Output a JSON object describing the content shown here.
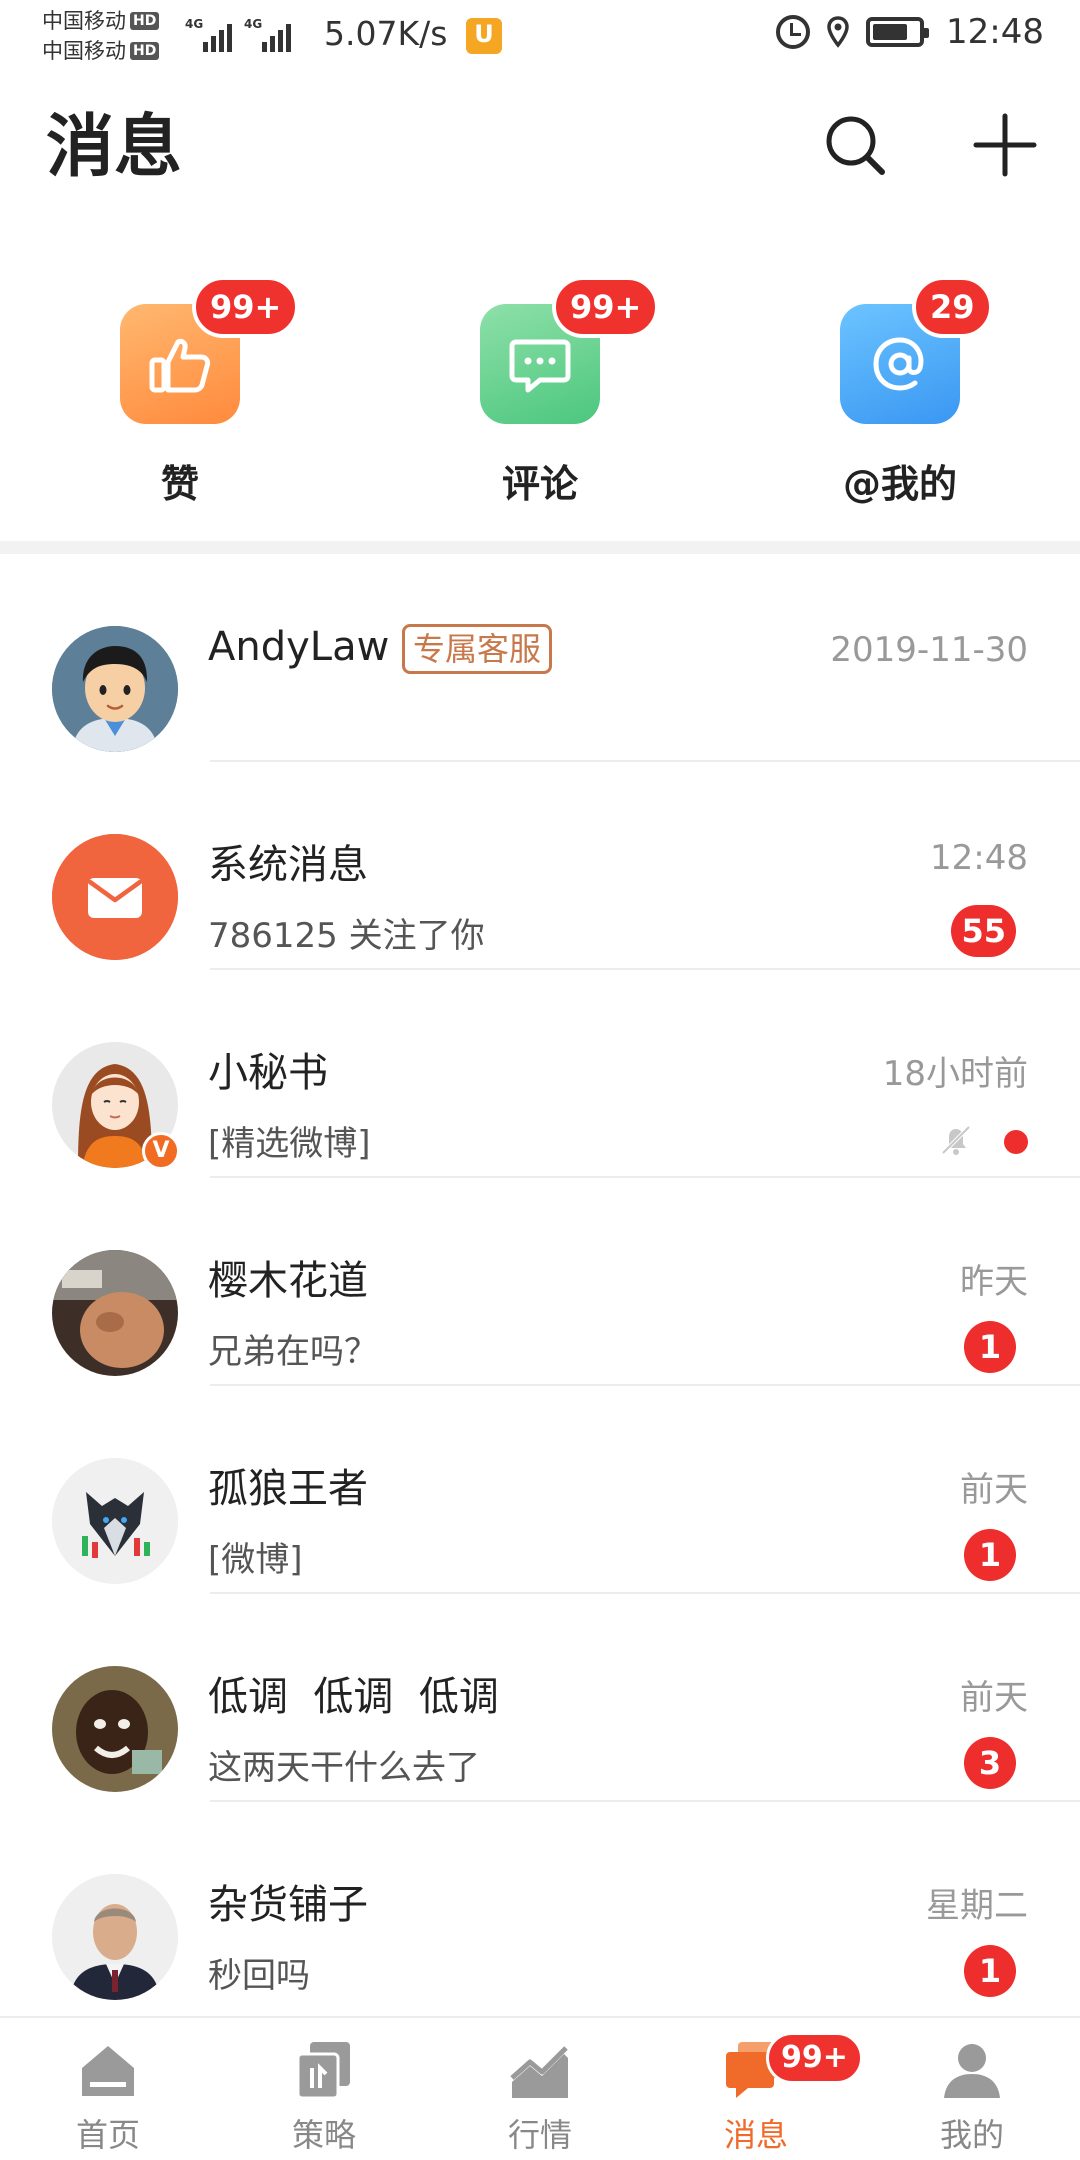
{
  "status_bar": {
    "carrier_1": "中国移动",
    "carrier_2": "中国移动",
    "hd_label": "HD",
    "network_type": "4G",
    "net_speed": "5.07K/s",
    "app_icon_letter": "U",
    "time": "12:48",
    "icons": [
      "alarm-icon",
      "location-icon",
      "battery-icon"
    ]
  },
  "header": {
    "title": "消息",
    "icons": [
      "search-icon",
      "plus-icon"
    ]
  },
  "categories": [
    {
      "label": "赞",
      "badge": "99+",
      "icon": "thumbs-up-icon",
      "color": "#ff9a4a"
    },
    {
      "label": "评论",
      "badge": "99+",
      "icon": "chat-bubble-icon",
      "color": "#5fcf8c"
    },
    {
      "label": "@我的",
      "badge": "29",
      "icon": "at-sign-icon",
      "color": "#4aa6f6"
    }
  ],
  "conversations": [
    {
      "name": "AndyLaw",
      "tag": "专属客服",
      "time": "2019-11-30",
      "preview": "",
      "badge": ""
    },
    {
      "name": "系统消息",
      "time": "12:48",
      "preview": "786125 关注了你",
      "badge": "55"
    },
    {
      "name": "小秘书",
      "time": "18小时前",
      "preview": "[精选微博]",
      "badge": "",
      "muted": true,
      "unread_dot": true
    },
    {
      "name": "樱木花道",
      "time": "昨天",
      "preview": "兄弟在吗？",
      "badge": "1"
    },
    {
      "name": "孤狼王者",
      "time": "前天",
      "preview": "[微博]",
      "badge": "1"
    },
    {
      "name": "低调  低调  低调",
      "time": "前天",
      "preview": "这两天干什么去了",
      "badge": "3"
    },
    {
      "name": "杂货铺子",
      "time": "星期二",
      "preview": "秒回吗",
      "badge": "1"
    }
  ],
  "bottom_nav": [
    {
      "label": "首页",
      "icon": "home-icon",
      "active": false
    },
    {
      "label": "策略",
      "icon": "strategy-icon",
      "active": false
    },
    {
      "label": "行情",
      "icon": "market-chart-icon",
      "active": false
    },
    {
      "label": "消息",
      "icon": "message-icon",
      "active": true,
      "badge": "99+"
    },
    {
      "label": "我的",
      "icon": "profile-icon",
      "active": false
    }
  ],
  "colors": {
    "accent": "#f06a2a",
    "badge_red": "#ee2e2c",
    "service_tag": "#c8794b"
  }
}
